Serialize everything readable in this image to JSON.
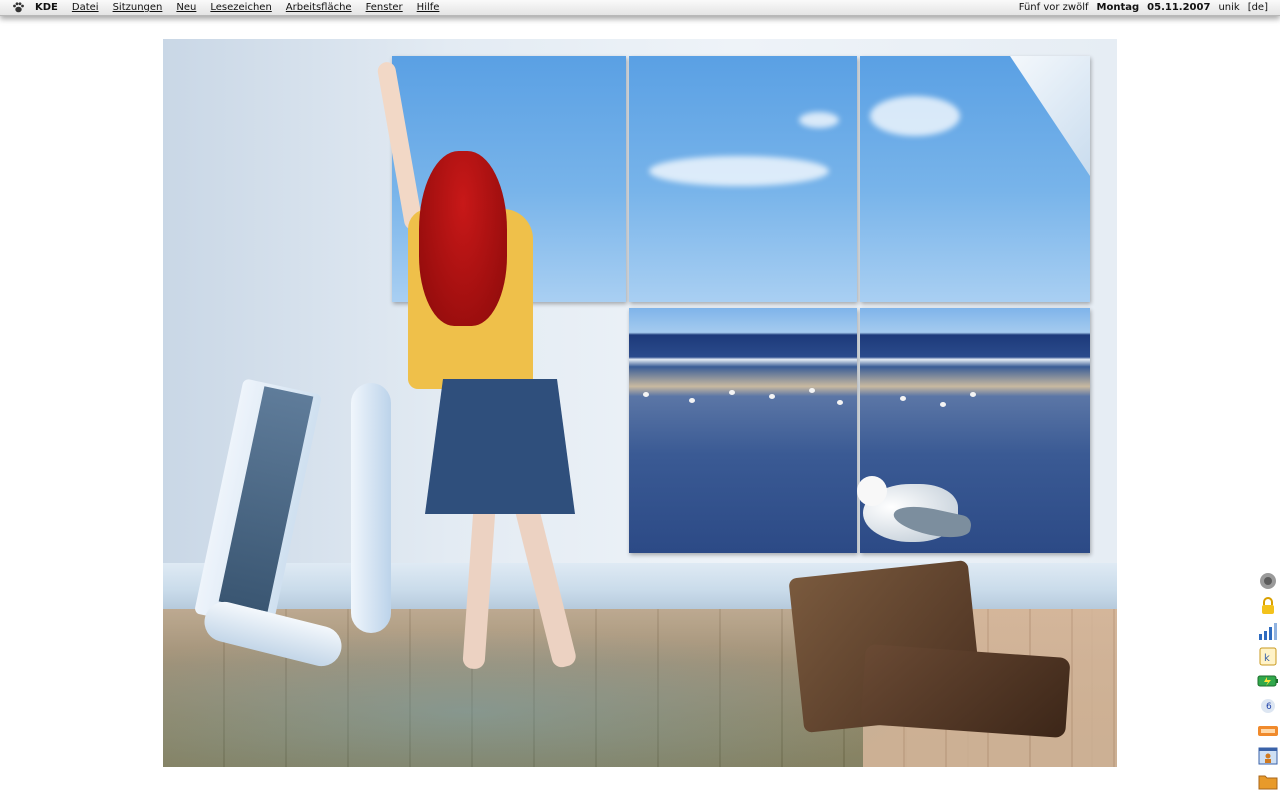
{
  "menubar": {
    "kmenu_icon": "kde-paw-icon",
    "app_label": "KDE",
    "menus": [
      "Datei",
      "Sitzungen",
      "Neu",
      "Lesezeichen",
      "Arbeitsfläche",
      "Fenster",
      "Hilfe"
    ],
    "clock_text": "Fünf vor zwölf",
    "weekday": "Montag",
    "date": "05.11.2007",
    "user": "unik",
    "keyboard_layout": "[de]"
  },
  "tray": {
    "icons": [
      "speaker-icon",
      "lock-icon",
      "signal-bars-icon",
      "kget-icon",
      "battery-icon",
      "notes-icon",
      "rss-icon",
      "user-window-icon",
      "folder-icon"
    ]
  },
  "colors": {
    "menubar_bg": "#ececec",
    "desktop_bg": "#ffffff"
  }
}
